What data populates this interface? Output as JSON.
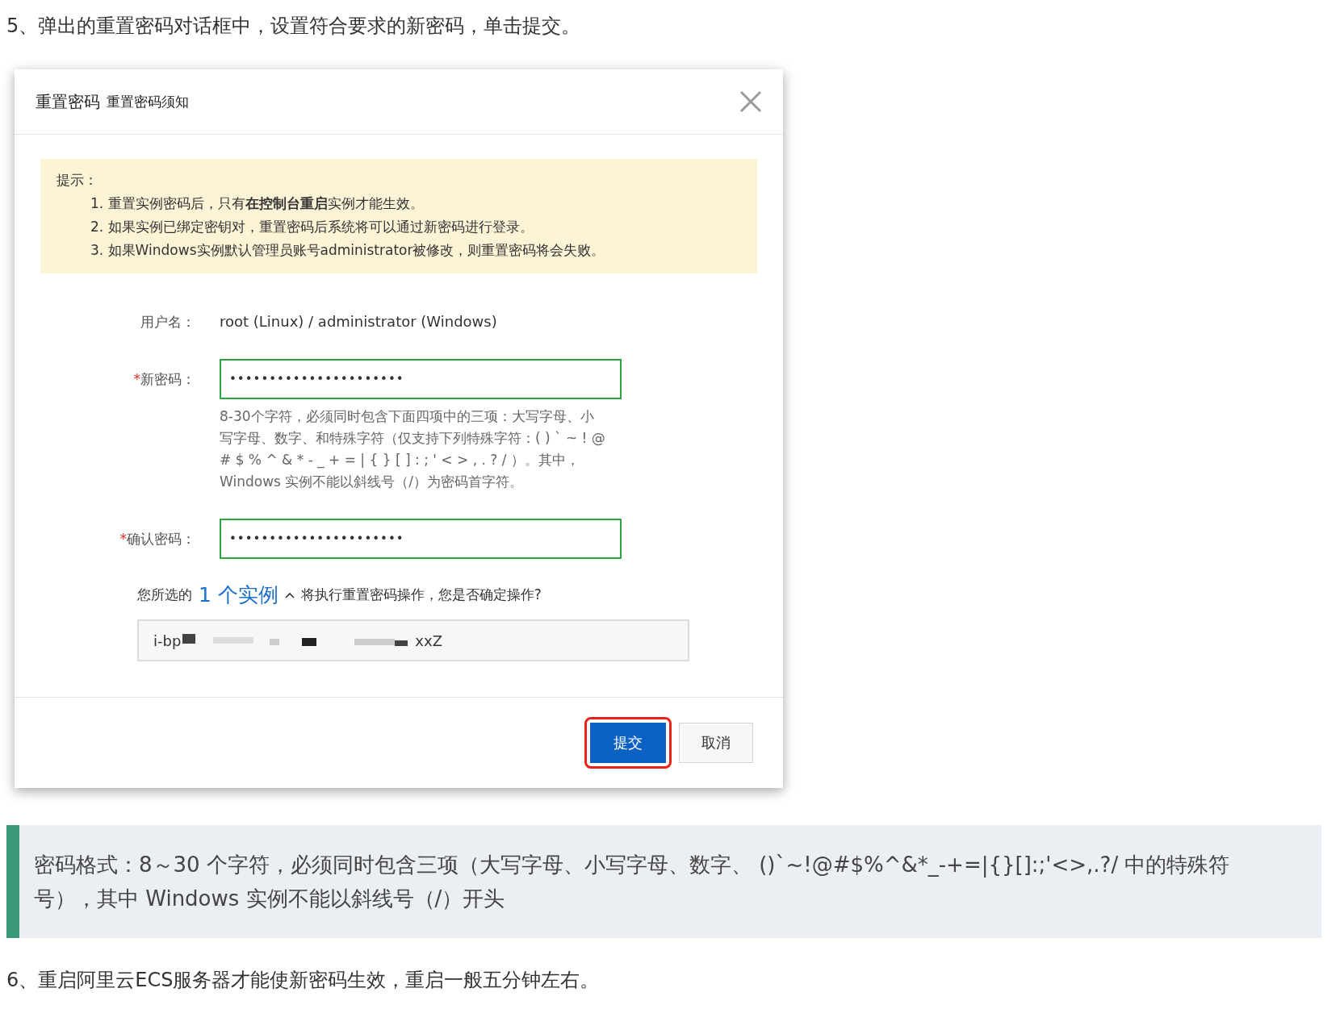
{
  "step_5": "5、弹出的重置密码对话框中，设置符合要求的新密码，单击提交。",
  "dialog": {
    "title": "重置密码",
    "subtitle": "重置密码须知",
    "notice": {
      "heading": "提示：",
      "items": [
        "1. 重置实例密码后，只有**在控制台重启**实例才能生效。",
        "2. 如果实例已绑定密钥对，重置密码后系统将可以通过新密码进行登录。",
        "3. 如果Windows实例默认管理员账号administrator被修改，则重置密码将会失败。"
      ]
    },
    "username": {
      "label": "用户名：",
      "value": "root (Linux) / administrator (Windows)"
    },
    "new_password": {
      "required_mark": "*",
      "label": "新密码：",
      "value": "••••••••••••••••••••••",
      "help": "8-30个字符，必须同时包含下面四项中的三项：大写字母、小写字母、数字、和特殊字符（仅支持下列特殊字符：( ) ` ~ ! @ # $ % ^ & * - _ + = | { } [ ] : ; ' < > , . ? / ）。其中，Windows 实例不能以斜线号（/）为密码首字符。"
    },
    "confirm_password": {
      "required_mark": "*",
      "label": "确认密码：",
      "value": "••••••••••••••••••••••"
    },
    "confirm_prefix": "您所选的",
    "instances_link": "1 个实例",
    "confirm_suffix": "将执行重置密码操作，您是否确定操作?",
    "instance_id_start": "i-bp",
    "instance_id_end": "xxZ",
    "buttons": [
      {
        "label": "提交",
        "kind": "primary",
        "highlighted": true
      },
      {
        "label": "取消",
        "kind": "default",
        "highlighted": false
      }
    ]
  },
  "note": "密码格式：8～30 个字符，必须同时包含三项（大写字母、小写字母、数字、 ()`~!@#$%^&*_-+=|{}[]:;'<>,.?/ 中的特殊符号），其中 Windows 实例不能以斜线号（/）开头",
  "step_6": "6、重启阿里云ECS服务器才能使新密码生效，重启一般五分钟左右。"
}
